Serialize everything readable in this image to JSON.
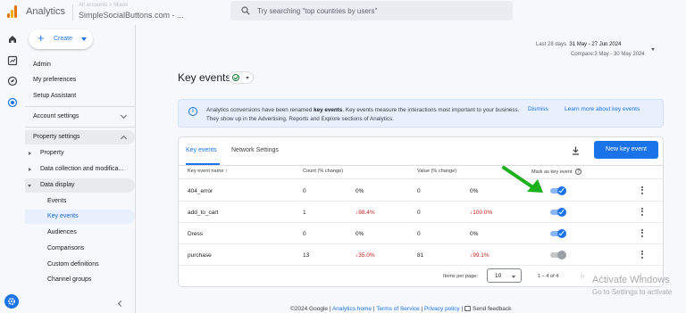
{
  "header": {
    "app_title": "Analytics",
    "account_line": "All accounts > Miaoli",
    "property": "SimpleSocialButtons.com - ...",
    "search_placeholder": "Try searching \"top countries by users\""
  },
  "nav": {
    "create_label": "Create",
    "items": [
      {
        "label": "Admin"
      },
      {
        "label": "My preferences"
      },
      {
        "label": "Setup Assistant"
      }
    ],
    "account_settings": "Account settings",
    "property_settings": "Property settings",
    "property": "Property",
    "data_collection": "Data collection and modifica...",
    "data_display": "Data display",
    "data_display_items": [
      "Events",
      "Key events",
      "Audiences",
      "Comparisons",
      "Custom definitions",
      "Channel groups"
    ]
  },
  "date": {
    "range_label": "Last 28 days",
    "range": "31 May - 27 Jun 2024",
    "compare": "Compare:3 May - 30 May 2024"
  },
  "page": {
    "title": "Key events"
  },
  "banner": {
    "text_pre": "Analytics conversions have been renamed ",
    "text_bold": "key events",
    "text_post": ". Key events measure the interactions most important to your business. They show up in the Advertising, Reports and Explore sections of Analytics.",
    "dismiss": "Dismiss",
    "learn_more": "Learn more about key events"
  },
  "table": {
    "tabs": [
      "Key events",
      "Network Settings"
    ],
    "new_button": "New key event",
    "headers": {
      "name": "Key event name ↑",
      "count": "Count (% change)",
      "value": "Value (% change)",
      "mark": "Mark as key event"
    },
    "rows": [
      {
        "name": "404_error",
        "count": "0",
        "count_change": "0%",
        "value": "0",
        "value_change": "0%",
        "marked": true
      },
      {
        "name": "add_to_cart",
        "count": "1",
        "count_change": "98.4%",
        "value": "0",
        "value_change": "100.0%",
        "marked": true
      },
      {
        "name": "Dress",
        "count": "0",
        "count_change": "0%",
        "value": "0",
        "value_change": "0%",
        "marked": true
      },
      {
        "name": "purchase",
        "count": "13",
        "count_change": "35.0%",
        "value": "81",
        "value_change": "99.1%",
        "marked": false
      }
    ],
    "pagination": {
      "items_per_page_label": "Items per page:",
      "items_per_page": "10",
      "range": "1 – 4 of 4"
    }
  },
  "footer": {
    "copyright": "©2024 Google |",
    "analytics_home": "Analytics home",
    "terms": "Terms of Service",
    "privacy": "Privacy policy",
    "send_feedback": "Send feedback"
  },
  "watermark": {
    "line1": "Activate Windows",
    "line2": "Go to Settings to activate"
  },
  "colors": {
    "accent": "#1a73e8",
    "negative": "#c5221f",
    "arrow": "#1db01d"
  }
}
